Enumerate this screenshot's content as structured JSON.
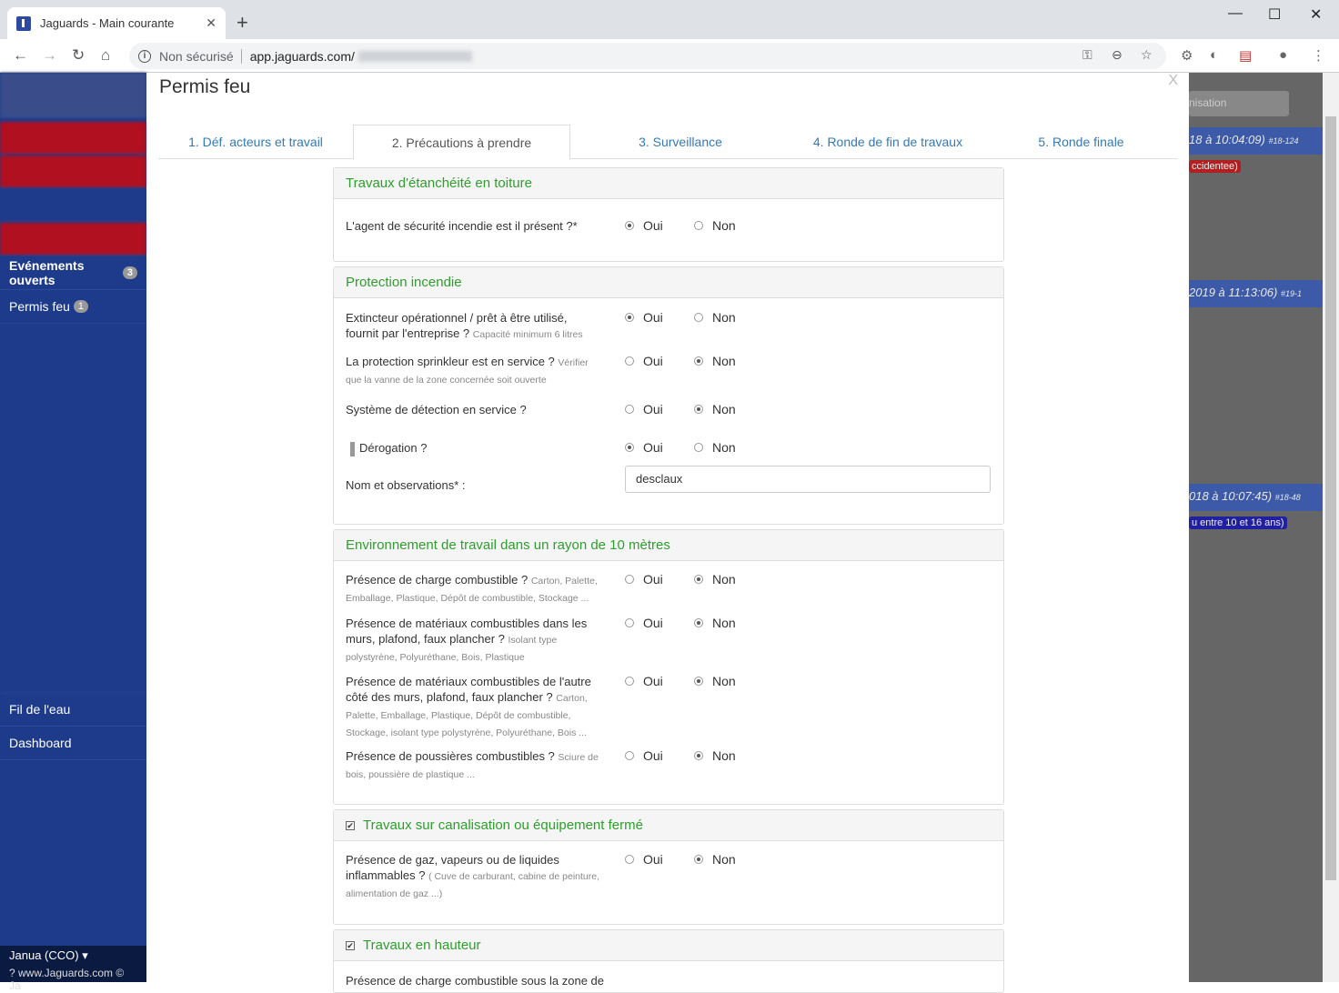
{
  "browser": {
    "tab_title": "Jaguards - Main courante",
    "new_tab": "+",
    "security": "Non sécurisé",
    "url": "app.jaguards.com/",
    "minimize": "—",
    "maximize": "☐",
    "close": "✕"
  },
  "sidebar": {
    "events_label": "Evénements ouverts",
    "events_count": "3",
    "permis_label": "Permis feu",
    "permis_count": "1",
    "fil": "Fil de l'eau",
    "dashboard": "Dashboard",
    "user": "Janua (CCO) ▾",
    "footer": "?  www.Jaguards.com © Ja"
  },
  "background": {
    "filter_placeholder": "nisation",
    "event1_date": "18 à 10:04:09)",
    "event1_id": "#18-124",
    "event1_tag": "ccidentee)",
    "event2_date": "2019 à 11:13:06)",
    "event2_id": "#19-1",
    "event3_date": "018 à 10:07:45)",
    "event3_id": "#18-48",
    "event3_tag": "u entre 10 et 16 ans)"
  },
  "modal": {
    "title": "Permis feu",
    "close": "X",
    "tabs": [
      "1. Déf. acteurs et travail",
      "2. Précautions à prendre",
      "3. Surveillance",
      "4. Ronde de fin de travaux",
      "5. Ronde finale"
    ],
    "yes": "Oui",
    "no": "Non"
  },
  "sections": {
    "s1": {
      "title": "Travaux d'étanchéité en toiture",
      "q1": "L'agent de sécurité incendie est il présent ?*"
    },
    "s2": {
      "title": "Protection incendie",
      "q1": "Extincteur opérationnel / prêt à être utilisé, fournit par l'entreprise ?",
      "q1_hint": "Capacité minimum 6 litres",
      "q2": "La protection sprinkleur est en service ?",
      "q2_hint": "Vérifier que la vanne de la zone concernée soit ouverte",
      "q3": "Système de détection en service ?",
      "q4": "Dérogation ?",
      "q5": "Nom et observations* :",
      "q5_value": "desclaux"
    },
    "s3": {
      "title": "Environnement de travail dans un rayon de 10 mètres",
      "q1": "Présence de charge combustible ?",
      "q1_hint": "Carton, Palette, Emballage, Plastique, Dépôt de combustible, Stockage ...",
      "q2": "Présence de matériaux combustibles dans les murs, plafond, faux plancher ?",
      "q2_hint": "Isolant type polystyrène, Polyuréthane, Bois, Plastique",
      "q3": "Présence de matériaux combustibles de l'autre côté des murs, plafond, faux plancher ?",
      "q3_hint": "Carton, Palette, Emballage, Plastique, Dépôt de combustible, Stockage, isolant type polystyrène, Polyuréthane, Bois ...",
      "q4": "Présence de poussières combustibles ?",
      "q4_hint": "Sciure de bois, poussière de plastique ..."
    },
    "s4": {
      "title": "Travaux sur canalisation ou équipement fermé",
      "q1": "Présence de gaz, vapeurs ou de liquides inflammables ?",
      "q1_hint": "( Cuve de carburant, cabine de peinture, alimentation de gaz ...)"
    },
    "s5": {
      "title": "Travaux en hauteur",
      "q1": "Présence de charge combustible sous la zone de"
    }
  }
}
